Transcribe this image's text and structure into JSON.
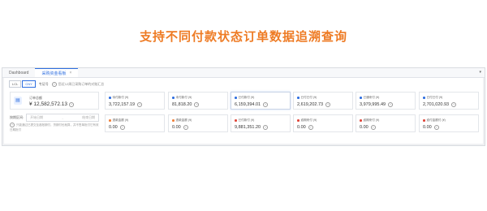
{
  "headline": "支持不同付款状态订单数据追溯查询",
  "tabs": [
    {
      "label": "Dashboard"
    },
    {
      "label": "采购资金看板",
      "close": "×"
    }
  ],
  "menu_icon": "▾",
  "filters": {
    "segments": [
      "LCL",
      "CNY"
    ],
    "currency_label": "专证号",
    "note": "您近12周已采购订单的对账汇总"
  },
  "total": {
    "icon": "chart-icon",
    "label": "订单总额",
    "value": "¥ 12,582,572.13"
  },
  "date": {
    "label": "按期区间:",
    "start_placeholder": "开始日期",
    "separator": "-",
    "end_placeholder": "结束日期"
  },
  "tip": "只能通过已提交至各账期付，货期付也就算，并不签单批付它有效日期批付",
  "cards_row1": [
    {
      "label": "待付款付 (¥)",
      "value": "3,722,157.19",
      "color": "#2f6fe0"
    },
    {
      "label": "未付款付 (¥)",
      "value": "81,818.20",
      "color": "#2f6fe0"
    },
    {
      "label": "已付款付 (¥)",
      "value": "6,159,394.01",
      "color": "#2f6fe0"
    },
    {
      "label": "已付已付 (¥)",
      "value": "2,619,202.73",
      "color": "#2f6fe0"
    },
    {
      "label": "已通来付 (¥)",
      "value": "3,979,995.49",
      "color": "#2f6fe0"
    },
    {
      "label": "已付已付 (¥)",
      "value": "2,701,020.93",
      "color": "#2f6fe0"
    }
  ],
  "cards_row2": [
    {
      "label": "退款金额 (¥)",
      "value": "0.00",
      "color": "#f0803a"
    },
    {
      "label": "退款金额 (¥)",
      "value": "0.00",
      "color": "#f0803a"
    },
    {
      "label": "已付款付 (¥)",
      "value": "9,881,351.20",
      "color": "#e0463a"
    },
    {
      "label": "逾期来付 (¥)",
      "value": "0.00",
      "color": "#e0463a"
    },
    {
      "label": "逾期来付 (¥)",
      "value": "0.00",
      "color": "#e0463a"
    },
    {
      "label": "逾付金额付 (¥)",
      "value": "0.00",
      "color": "#e0463a"
    }
  ],
  "info_glyph": "?"
}
